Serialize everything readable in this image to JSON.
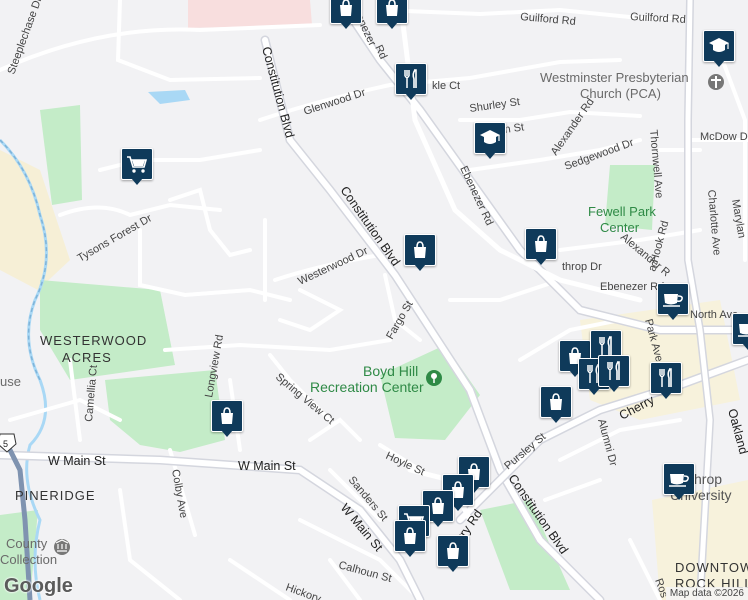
{
  "map": {
    "neighborhoods": [
      "WESTERWOOD",
      "ACRES",
      "PINERIDGE",
      "DOWNTOWN",
      "ROCK HILL"
    ],
    "places": [
      "Westminster Presbyterian",
      "Church (PCA)",
      "Fewell Park",
      "Center",
      "Boyd Hill",
      "Recreation Center",
      "Winthrop",
      "University",
      "County",
      "Collection",
      "use"
    ],
    "roads": {
      "guilford_rd_1": "Guilford Rd",
      "guilford_rd_2": "Guilford Rd",
      "steeplechase": "Steeplechase Dr",
      "glenwood": "Glenwood Dr",
      "constitution_1": "Constitution Blvd",
      "constitution_2": "Constitution Blvd",
      "constitution_3": "Constitution Blvd",
      "ebenezer_1": "Ebenezer Rd",
      "ebenezer_2": "Ebenezer Rd",
      "ebenezer_3": "Ebenezer",
      "shurley": "Shurley St",
      "alexander_1": "Alexander Rd",
      "alexander_2": "Alexander R",
      "sedgewood": "Sedgewood Dr",
      "mcdow": "McDow Dr",
      "thornwell": "Thornwell Ave",
      "charlotte": "Charlotte Ave",
      "maryland": "Marylan",
      "tysons": "Tysons Forest Dr",
      "westerwood_dr": "Westerwood Dr",
      "fargo": "Fargo St",
      "spring_view": "Spring View Ct",
      "longview": "Longview Rd",
      "camellia": "Camellia Ct",
      "colby": "Colby Ave",
      "w_main_1": "W Main St",
      "w_main_2": "W Main St",
      "w_main_3": "W Main St",
      "hoyle": "Hoyle St",
      "sanders": "Sanders St",
      "cherry_1": "Cherry Rd",
      "cherry_2": "Cherry",
      "pursley": "Pursley St",
      "alumni": "Alumni Dr",
      "park_ave": "Park Ave",
      "north_ave": "North Ave",
      "oakland": "Oakland",
      "calhoun": "Calhoun St",
      "hickory": "Hickory",
      "ros": "Ros",
      "throp": "throp Dr",
      "kle": "kle Ct",
      "hook": "a Hook Rd",
      "rd_frag": "Rd",
      "h_st": "h St",
      "route_5": "5"
    },
    "pois": [
      {
        "type": "shopping",
        "icon": "shopping-bag-icon"
      },
      {
        "type": "restaurant",
        "icon": "fork-knife-icon"
      },
      {
        "type": "school",
        "icon": "graduation-cap-icon"
      },
      {
        "type": "grocery",
        "icon": "shopping-cart-icon"
      },
      {
        "type": "cafe",
        "icon": "coffee-cup-icon"
      }
    ],
    "colors": {
      "background": "#f2f2f4",
      "road": "#ffffff",
      "major_road": "#e2e4ea",
      "park": "#c4ecc8",
      "park_text": "#2f8a46",
      "water": "#a9d8f5",
      "pin": "#0f3a5a",
      "hospital_area": "#f8dede",
      "campus": "#f7f2dc"
    }
  },
  "footer": {
    "logo": "Google",
    "attribution": "Map data ©2026"
  }
}
